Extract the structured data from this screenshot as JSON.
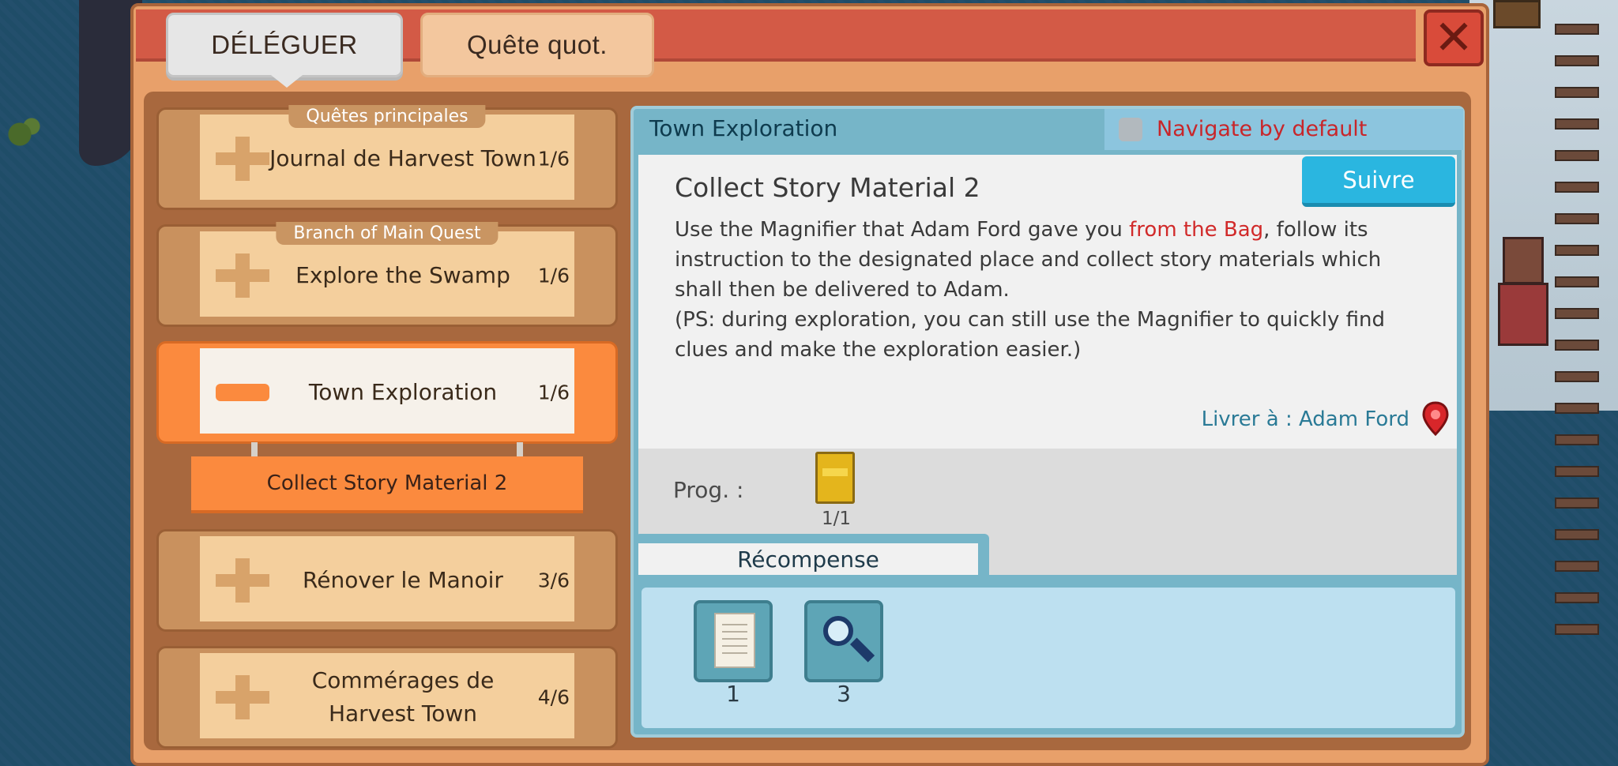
{
  "tabs": {
    "delegate": "DÉLÉGUER",
    "daily": "Quête quot."
  },
  "close_label": "✕",
  "quests": [
    {
      "tag": "Quêtes principales",
      "name": "Journal de Harvest Town",
      "count": "1/6"
    },
    {
      "tag": "Branch of Main Quest",
      "name": "Explore the Swamp",
      "count": "1/6"
    },
    {
      "name": "Town Exploration",
      "count": "1/6"
    },
    {
      "name": "Rénover le Manoir",
      "count": "3/6"
    },
    {
      "name": "Commérages de Harvest Town",
      "count": "4/6"
    }
  ],
  "subquest": "Collect Story Material 2",
  "detail": {
    "header_title": "Town Exploration",
    "navigate_label": "Navigate by default",
    "title": "Collect Story Material 2",
    "follow_label": "Suivre",
    "desc_part1": "Use the Magnifier that Adam Ford gave you ",
    "desc_highlight": "from the Bag",
    "desc_part2": ", follow its instruction to the designated place and collect story materials which shall then be delivered to Adam.",
    "desc_ps": "(PS: during exploration, you can still use the Magnifier to quickly find clues and make the exploration easier.)",
    "deliver_to": "Livrer à : Adam Ford",
    "progress_label": "Prog. :",
    "progress_count": "1/1",
    "reward_title": "Récompense",
    "rewards": [
      {
        "icon": "paper-icon",
        "count": "1"
      },
      {
        "icon": "magnifier-icon",
        "count": "3"
      }
    ]
  },
  "colors": {
    "header": "#d35a46",
    "active": "#fb8a3e",
    "follow": "#2ab6e0",
    "highlight": "#d12a2a"
  }
}
